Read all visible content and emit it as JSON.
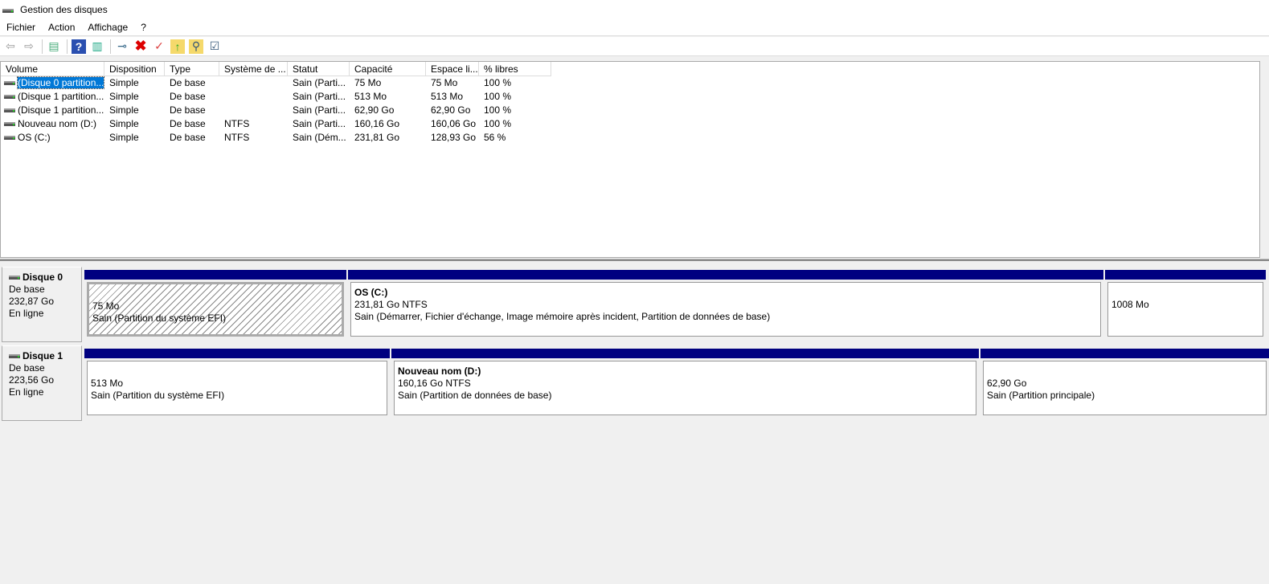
{
  "title": "Gestion des disques",
  "menu": [
    "Fichier",
    "Action",
    "Affichage",
    "?"
  ],
  "columns": [
    "Volume",
    "Disposition",
    "Type",
    "Système de ...",
    "Statut",
    "Capacité",
    "Espace li...",
    "% libres"
  ],
  "volumes": [
    [
      "(Disque 0 partition...",
      "Simple",
      "De base",
      "",
      "Sain (Parti...",
      "75 Mo",
      "75 Mo",
      "100 %"
    ],
    [
      "(Disque 1 partition...",
      "Simple",
      "De base",
      "",
      "Sain (Parti...",
      "513 Mo",
      "513 Mo",
      "100 %"
    ],
    [
      "(Disque 1 partition...",
      "Simple",
      "De base",
      "",
      "Sain (Parti...",
      "62,90 Go",
      "62,90 Go",
      "100 %"
    ],
    [
      "Nouveau nom (D:)",
      "Simple",
      "De base",
      "NTFS",
      "Sain (Parti...",
      "160,16 Go",
      "160,06 Go",
      "100 %"
    ],
    [
      "OS (C:)",
      "Simple",
      "De base",
      "NTFS",
      "Sain (Dém...",
      "231,81 Go",
      "128,93 Go",
      "56 %"
    ]
  ],
  "disks": [
    {
      "name": "Disque 0",
      "type": "De base",
      "size": "232,87 Go",
      "status": "En ligne",
      "partitions": [
        {
          "name": "",
          "size": "75 Mo",
          "status": "Sain (Partition du système EFI)"
        },
        {
          "name": "OS  (C:)",
          "size": "231,81 Go NTFS",
          "status": "Sain (Démarrer, Fichier d'échange, Image mémoire après incident, Partition de données de base)"
        },
        {
          "name": "",
          "size": "1008 Mo",
          "status": ""
        }
      ]
    },
    {
      "name": "Disque 1",
      "type": "De base",
      "size": "223,56 Go",
      "status": "En ligne",
      "partitions": [
        {
          "name": "",
          "size": "513 Mo",
          "status": "Sain (Partition du système EFI)"
        },
        {
          "name": "Nouveau nom  (D:)",
          "size": "160,16 Go NTFS",
          "status": "Sain (Partition de données de base)"
        },
        {
          "name": "",
          "size": "62,90 Go",
          "status": "Sain (Partition principale)"
        }
      ]
    }
  ]
}
